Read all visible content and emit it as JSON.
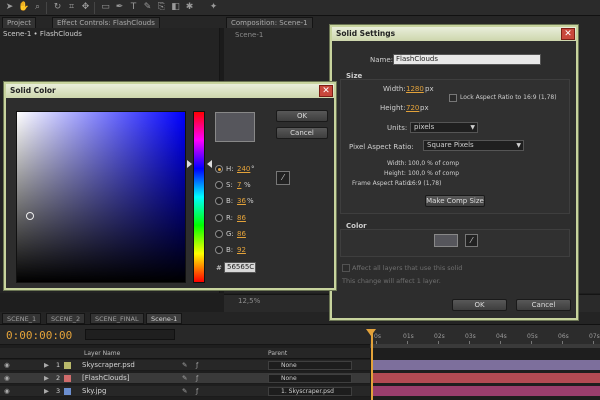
{
  "toolbar": {
    "tools": [
      "select",
      "hand",
      "zoom",
      "rotate",
      "camera",
      "pan",
      "mask",
      "pen",
      "text",
      "brush",
      "clone",
      "eraser",
      "puppet"
    ]
  },
  "panels": {
    "project_tab": "Project",
    "effects_tab": "Effect Controls: FlashClouds",
    "comp_tab": "Composition: Scene-1",
    "project_scene": "Scene-1 • FlashClouds",
    "comp_scene": "Scene-1",
    "zoom": "12,5%"
  },
  "timeline": {
    "tabs": [
      "SCENE_1",
      "SCENE_2",
      "SCENE_FINAL",
      "Scene-1"
    ],
    "active_tab": 3,
    "timecode": "0:00:00:00",
    "ticks": [
      "0s",
      "01s",
      "02s",
      "03s",
      "04s",
      "05s",
      "06s",
      "07s"
    ],
    "col_layer_name": "Layer Name",
    "col_parent": "Parent",
    "layers": [
      {
        "num": "1",
        "name": "Skyscraper.psd",
        "parent": "None",
        "label_color": "#b8b86a",
        "bar_color": "#7d6f9c"
      },
      {
        "num": "2",
        "name": "[FlashClouds]",
        "parent": "None",
        "label_color": "#d06c6c",
        "bar_color": "#b34a53"
      },
      {
        "num": "3",
        "name": "Sky.jpg",
        "parent": "1. Skyscraper.psd",
        "label_color": "#6c8fd0",
        "bar_color": "#9a3e6d"
      }
    ]
  },
  "solid_settings": {
    "title": "Solid Settings",
    "name_label": "Name:",
    "name_value": "FlashClouds",
    "size_label": "Size",
    "width_label": "Width:",
    "width_value": "1280",
    "height_label": "Height:",
    "height_value": "720",
    "px": "px",
    "lock_label": "Lock Aspect Ratio to 16:9 (1,78)",
    "units_label": "Units:",
    "units_value": "pixels",
    "par_label": "Pixel Aspect Ratio:",
    "par_value": "Square Pixels",
    "info_width_label": "Width:",
    "info_width_value": "100,0 % of comp",
    "info_height_label": "Height:",
    "info_height_value": "100,0 % of comp",
    "frame_ar_label": "Frame Aspect Ratio:",
    "frame_ar_value": "16:9 (1,78)",
    "make_comp_size": "Make Comp Size",
    "color_label": "Color",
    "affect_all": "Affect all layers that use this solid",
    "change_note": "This change will affect 1 layer.",
    "ok": "OK",
    "cancel": "Cancel"
  },
  "solid_color": {
    "title": "Solid Color",
    "ok": "OK",
    "cancel": "Cancel",
    "h_label": "H:",
    "h_value": "240",
    "h_unit": "°",
    "s_label": "S:",
    "s_value": "7",
    "s_unit": "%",
    "b_label": "B:",
    "b_value": "36",
    "b_unit": "%",
    "r_label": "R:",
    "r_value": "86",
    "g_label": "G:",
    "g_value": "86",
    "bl_label": "B:",
    "bl_value": "92",
    "hex_label": "#",
    "hex_value": "56565C",
    "current_color": "#56565c"
  }
}
